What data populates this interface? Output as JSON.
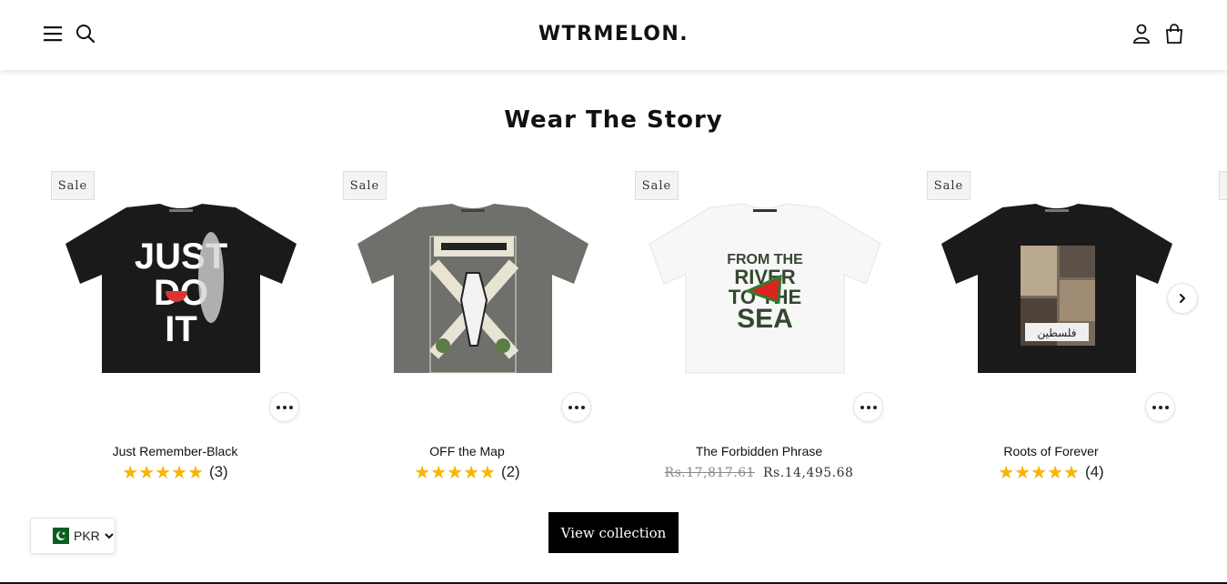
{
  "header": {
    "logo": "WTRMELON.",
    "icons": [
      "menu-icon",
      "search-icon",
      "account-icon",
      "cart-icon"
    ]
  },
  "section": {
    "title": "Wear The Story"
  },
  "products": [
    {
      "badge": "Sale",
      "title": "Just Remember-Black",
      "rating": 5,
      "reviews": "(3)"
    },
    {
      "badge": "Sale",
      "title": "OFF the Map",
      "rating": 5,
      "reviews": "(2)"
    },
    {
      "badge": "Sale",
      "title": "The Forbidden Phrase",
      "old_price": "Rs.17,817.61",
      "new_price": "Rs.14,495.68"
    },
    {
      "badge": "Sale",
      "title": "Roots of Forever",
      "rating": 5,
      "reviews": "(4)"
    }
  ],
  "view_collection": "View collection",
  "currency": {
    "code": "PKR"
  },
  "colors": {
    "accent": "#000000",
    "star": "#f5b50a",
    "badge_bg": "#f4f4f4"
  }
}
